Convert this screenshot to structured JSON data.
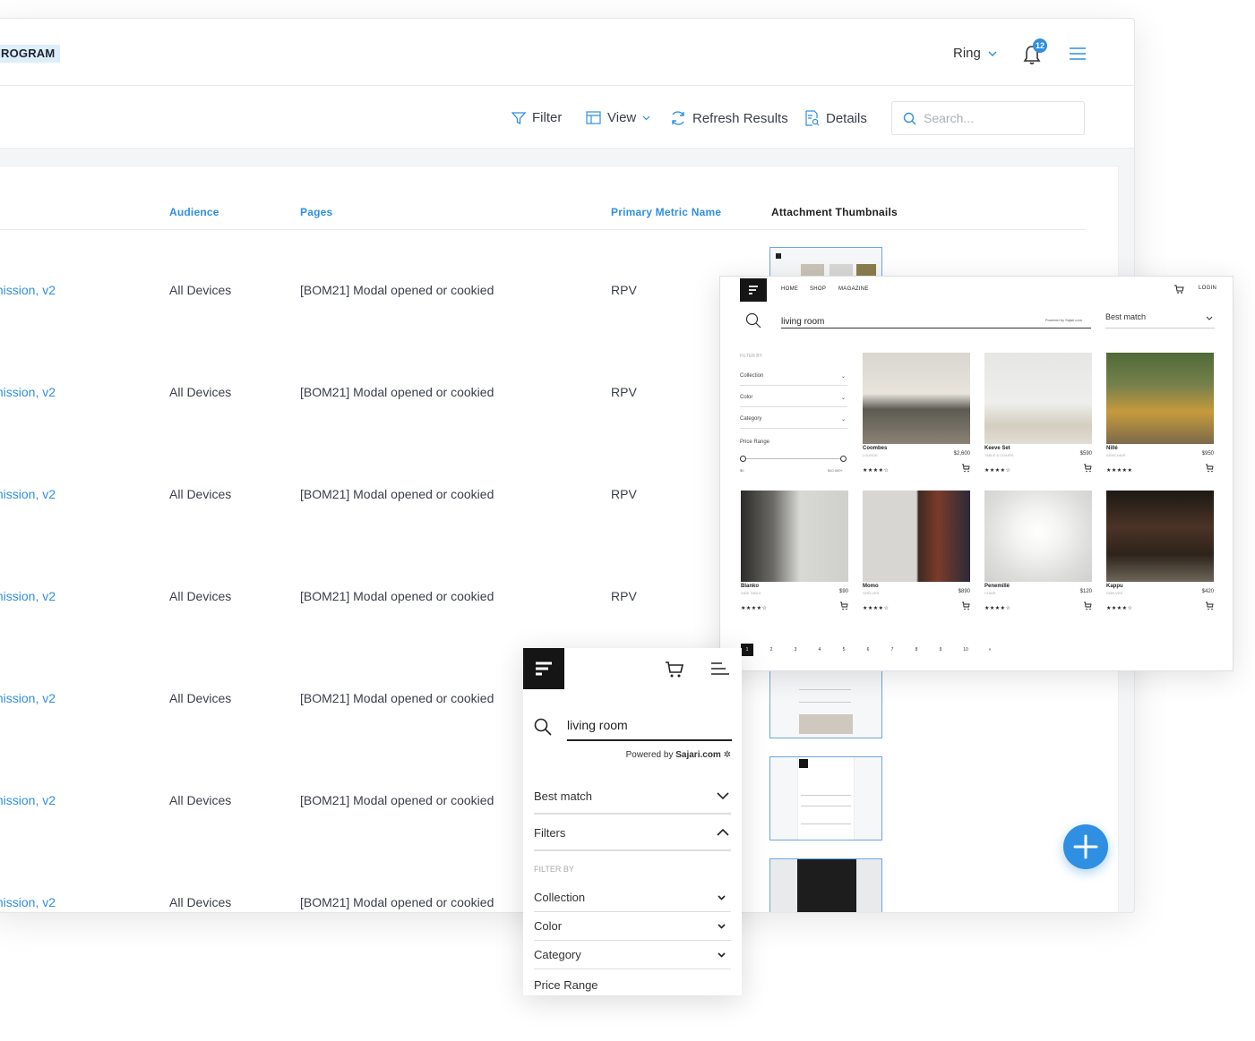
{
  "header": {
    "program_label": "ROGRAM",
    "user_name": "Ring",
    "notification_count": "12"
  },
  "toolbar": {
    "filter_label": "Filter",
    "view_label": "View",
    "refresh_label": "Refresh Results",
    "details_label": "Details",
    "search_placeholder": "Search..."
  },
  "table": {
    "columns": [
      "Audience",
      "Pages",
      "Primary Metric Name",
      "Attachment Thumbnails"
    ],
    "rows": [
      {
        "name": "mission, v2",
        "audience": "All Devices",
        "pages": "[BOM21] Modal opened or cookied",
        "metric": "RPV"
      },
      {
        "name": "mission, v2",
        "audience": "All Devices",
        "pages": "[BOM21] Modal opened or cookied",
        "metric": "RPV"
      },
      {
        "name": "mission, v2",
        "audience": "All Devices",
        "pages": "[BOM21] Modal opened or cookied",
        "metric": "RPV"
      },
      {
        "name": "mission, v2",
        "audience": "All Devices",
        "pages": "[BOM21] Modal opened or cookied",
        "metric": "RPV"
      },
      {
        "name": "mission, v2",
        "audience": "All Devices",
        "pages": "[BOM21] Modal opened or cookied",
        "metric": ""
      },
      {
        "name": "mission, v2",
        "audience": "All Devices",
        "pages": "[BOM21] Modal opened or cookied",
        "metric": ""
      },
      {
        "name": "mission, v2",
        "audience": "All Devices",
        "pages": "[BOM21] Modal opened or cookied",
        "metric": ""
      }
    ]
  },
  "desktop_preview": {
    "nav": [
      "HOME",
      "SHOP",
      "MAGAZINE"
    ],
    "login": "LOGIN",
    "search_query": "living room",
    "powered_by": "Powered by Sajari.com",
    "sort_label": "Best match",
    "filter_by": "FILTER BY",
    "filters": [
      "Collection",
      "Color",
      "Category"
    ],
    "price_range_label": "Price Range",
    "price_min": "$0",
    "price_max": "$10,000+",
    "products": [
      {
        "name": "Coombes",
        "category": "LOUNGE",
        "price": "$2,600",
        "stars": "★★★★☆"
      },
      {
        "name": "Keeve Set",
        "category": "TABLE & CHAIRS",
        "price": "$590",
        "stars": "★★★★☆"
      },
      {
        "name": "Nillé",
        "category": "ARMCHAIR",
        "price": "$950",
        "stars": "★★★★★"
      },
      {
        "name": "Blanko",
        "category": "SIDE TABLE",
        "price": "$90",
        "stars": "★★★★☆"
      },
      {
        "name": "Momo",
        "category": "SHELVES",
        "price": "$890",
        "stars": "★★★★☆"
      },
      {
        "name": "Penemillè",
        "category": "CHAIR",
        "price": "$120",
        "stars": "★★★★☆"
      },
      {
        "name": "Kappu",
        "category": "SHELVES",
        "price": "$420",
        "stars": "★★★★☆"
      }
    ],
    "pages": [
      "1",
      "2",
      "3",
      "4",
      "5",
      "6",
      "7",
      "8",
      "9",
      "10",
      "»"
    ]
  },
  "mobile_preview": {
    "search_query": "living room",
    "powered_by_prefix": "Powered by",
    "powered_by_brand": "Sajari.com",
    "sort_label": "Best match",
    "filters_label": "Filters",
    "filter_by": "FILTER BY",
    "filters": [
      "Collection",
      "Color",
      "Category"
    ],
    "price_range_label": "Price Range"
  },
  "colors": {
    "accent": "#2f8fe2",
    "program_tag_bg": "#ddeefa",
    "text": "#3a3f4a"
  }
}
